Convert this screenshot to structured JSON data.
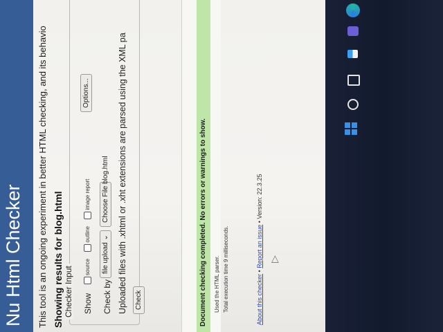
{
  "banner": {
    "title": "Nu Html Checker"
  },
  "intro_text": "This tool is an ongoing experiment in better HTML checking, and its behavio",
  "showing_results": "Showing results for blog.html",
  "checker_input": {
    "legend": "Checker Input",
    "show_label": "Show",
    "checkboxes": [
      "source",
      "outline",
      "image report"
    ],
    "options_button": "Options...",
    "check_by_label": "Check by",
    "check_by_select": "file upload",
    "choose_file_button": "Choose File",
    "file_name": "blog.html",
    "upload_note": "Uploaded files with .xhtml or .xht extensions are parsed using the XML pa",
    "check_button": "Check"
  },
  "results": {
    "success_message": "Document checking completed. No errors or warnings to show.",
    "parser_note": "Used the HTML parser.",
    "exec_time": "Total execution time 9 milliseconds."
  },
  "footer": {
    "about_link": "About this checker",
    "separator": " • ",
    "report_link": "Report an issue",
    "version": "Version: 22.3.25"
  },
  "taskbar": {
    "icons": [
      "windows-start-icon",
      "search-icon",
      "task-view-icon",
      "widgets-icon",
      "teams-chat-icon",
      "edge-icon"
    ]
  },
  "colors": {
    "banner": "#365d95",
    "success_bg": "#bfe6a8",
    "link": "#2d4ab8",
    "taskbar": "#121a2e"
  }
}
